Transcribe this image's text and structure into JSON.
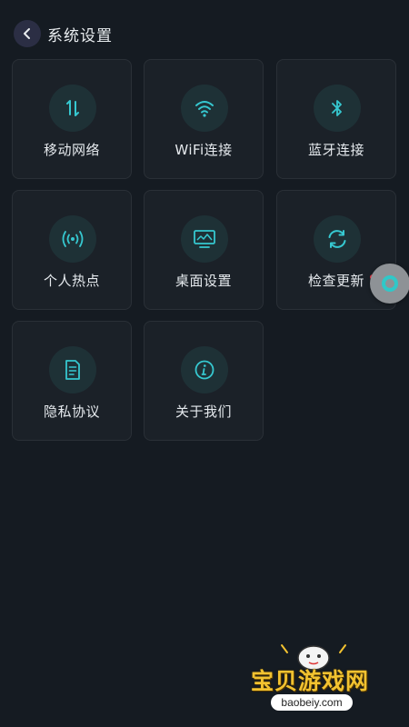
{
  "header": {
    "title": "系统设置"
  },
  "tiles": [
    {
      "label": "移动网络",
      "icon": "mobile-data-icon"
    },
    {
      "label": "WiFi连接",
      "icon": "wifi-icon"
    },
    {
      "label": "蓝牙连接",
      "icon": "bluetooth-icon"
    },
    {
      "label": "个人热点",
      "icon": "hotspot-icon"
    },
    {
      "label": "桌面设置",
      "icon": "desktop-icon"
    },
    {
      "label": "检查更新",
      "icon": "refresh-icon",
      "badge": true
    },
    {
      "label": "隐私协议",
      "icon": "document-icon"
    },
    {
      "label": "关于我们",
      "icon": "info-icon"
    }
  ],
  "watermark": {
    "name": "宝贝游戏网",
    "url": "baobeiy.com"
  },
  "colors": {
    "background": "#151b22",
    "tile": "#1b2128",
    "accent": "#36c8d0",
    "badge": "#ff3b4a"
  }
}
